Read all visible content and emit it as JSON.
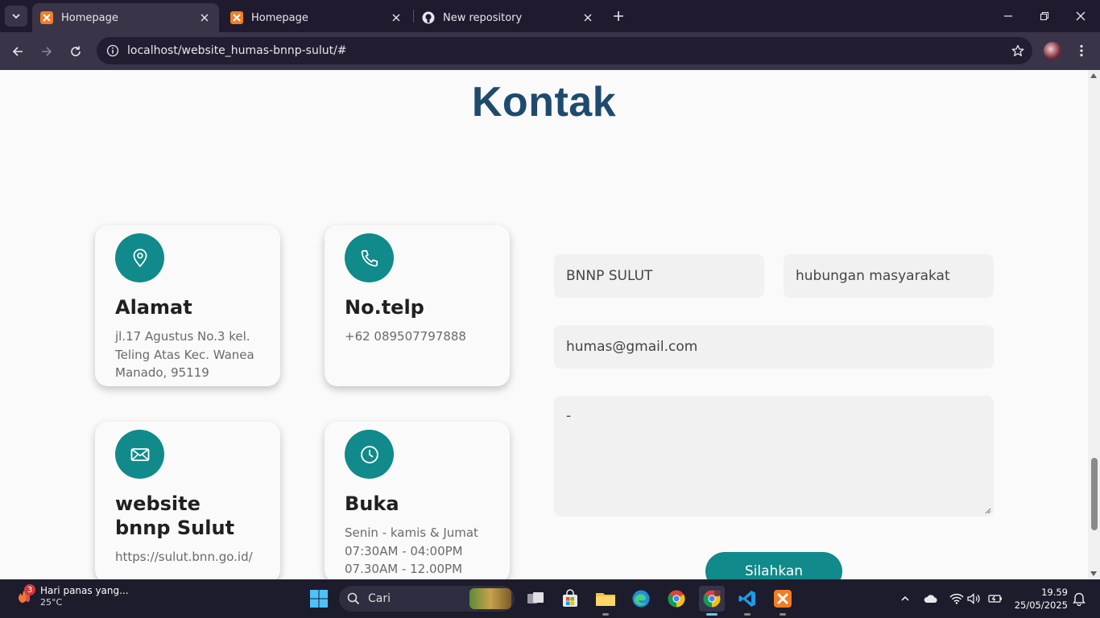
{
  "browser": {
    "tabs": [
      {
        "title": "Homepage",
        "icon": "xampp-icon",
        "active": true
      },
      {
        "title": "Homepage",
        "icon": "xampp-icon",
        "active": false
      },
      {
        "title": "New repository",
        "icon": "github-icon",
        "active": false
      }
    ],
    "url": "localhost/website_humas-bnnp-sulut/#"
  },
  "page": {
    "heading": "Kontak",
    "cards": [
      {
        "icon": "location-pin-icon",
        "title": "Alamat",
        "text": "jl.17 Agustus No.3 kel. Teling Atas Kec. Wanea Manado, 95119"
      },
      {
        "icon": "phone-icon",
        "title": "No.telp",
        "text": "+62 089507797888"
      },
      {
        "icon": "envelope-icon",
        "title": "website bnnp Sulut",
        "text": "https://sulut.bnn.go.id/"
      },
      {
        "icon": "clock-icon",
        "title": "Buka",
        "lines": [
          "Senin - kamis & Jumat",
          "07:30AM - 04:00PM",
          "07.30AM - 12.00PM"
        ]
      }
    ],
    "form": {
      "name_value": "BNNP SULUT",
      "subject_value": "hubungan masyarakat",
      "email_value": "humas@gmail.com",
      "message_value": "-",
      "submit_label": "Silahkan"
    }
  },
  "taskbar": {
    "weather_title": "Hari panas yang...",
    "weather_temp": "25°C",
    "weather_badge": "3",
    "search_placeholder": "Cari",
    "time": "19.59",
    "date": "25/05/2025"
  },
  "colors": {
    "accent": "#108a8a",
    "heading": "#1e4a6e",
    "field_bg": "#f1f1f1"
  }
}
